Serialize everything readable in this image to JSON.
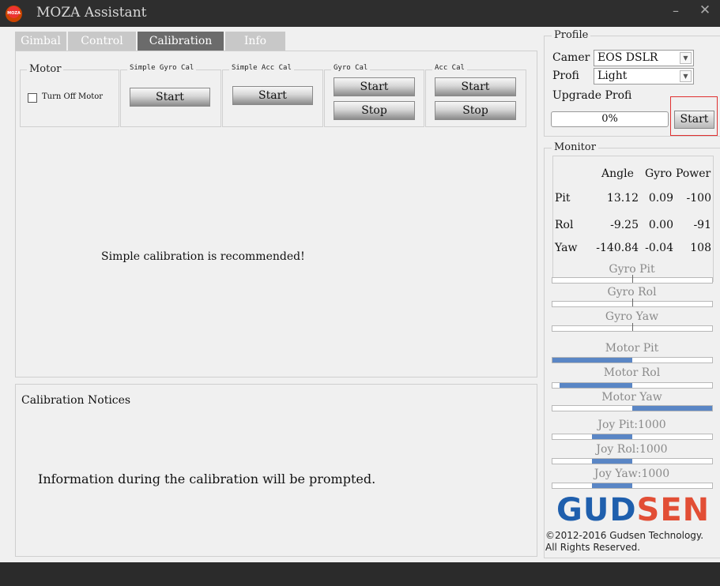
{
  "window": {
    "title": "MOZA Assistant",
    "logo_text": "MOZA",
    "minimize": "–",
    "close": "✕"
  },
  "tabs": [
    {
      "label": "Gimbal"
    },
    {
      "label": "Control"
    },
    {
      "label": "Calibration"
    },
    {
      "label": "Info"
    }
  ],
  "calibration": {
    "motor": {
      "title": "Motor",
      "checkbox_label": "Turn Off Motor",
      "checked": false
    },
    "simple_gyro": {
      "title": "Simple Gyro Cal",
      "start": "Start"
    },
    "simple_acc": {
      "title": "Simple Acc Cal",
      "start": "Start"
    },
    "gyro_cal": {
      "title": "Gyro Cal",
      "start": "Start",
      "stop": "Stop"
    },
    "acc_cal": {
      "title": "Acc Cal",
      "start": "Start",
      "stop": "Stop"
    },
    "message": "Simple calibration is recommended!"
  },
  "notices": {
    "title": "Calibration Notices",
    "text": "Information during the calibration will be prompted."
  },
  "profile": {
    "title": "Profile",
    "camera_label": "Camer",
    "camera_value": "EOS DSLR",
    "profile_label": "Profi",
    "profile_value": "Light",
    "upgrade_label": "Upgrade Profi",
    "progress_text": "0%",
    "start": "Start"
  },
  "monitor": {
    "title": "Monitor",
    "headers": [
      "Angle",
      "Gyro",
      "Power"
    ],
    "rows": [
      {
        "axis": "Pit",
        "angle": "13.12",
        "gyro": "0.09",
        "power": "-100"
      },
      {
        "axis": "Rol",
        "angle": "-9.25",
        "gyro": "0.00",
        "power": "-91"
      },
      {
        "axis": "Yaw",
        "angle": "-140.84",
        "gyro": "-0.04",
        "power": "108"
      }
    ],
    "sliders": [
      {
        "label": "Gyro Pit",
        "value": 0.0
      },
      {
        "label": "Gyro Rol",
        "value": 0.0
      },
      {
        "label": "Gyro Yaw",
        "value": 0.0
      },
      {
        "label": "Motor Pit",
        "value": -1.0
      },
      {
        "label": "Motor Rol",
        "value": -0.91
      },
      {
        "label": "Motor Yaw",
        "value": 1.0
      },
      {
        "label": "Joy Pit:1000",
        "value": -0.5
      },
      {
        "label": "Joy Rol:1000",
        "value": -0.5
      },
      {
        "label": "Joy Yaw:1000",
        "value": -0.5
      }
    ]
  },
  "brand": {
    "logo_a": "GUD",
    "logo_b": "SEN",
    "copyright_1": "©2012-2016 Gudsen Technology.",
    "copyright_2": "All Rights Reserved."
  },
  "colors": {
    "accent_blue": "#5a86c5",
    "brand_blue": "#1f5fad",
    "brand_red": "#e24e35",
    "highlight_red": "#e03030"
  }
}
